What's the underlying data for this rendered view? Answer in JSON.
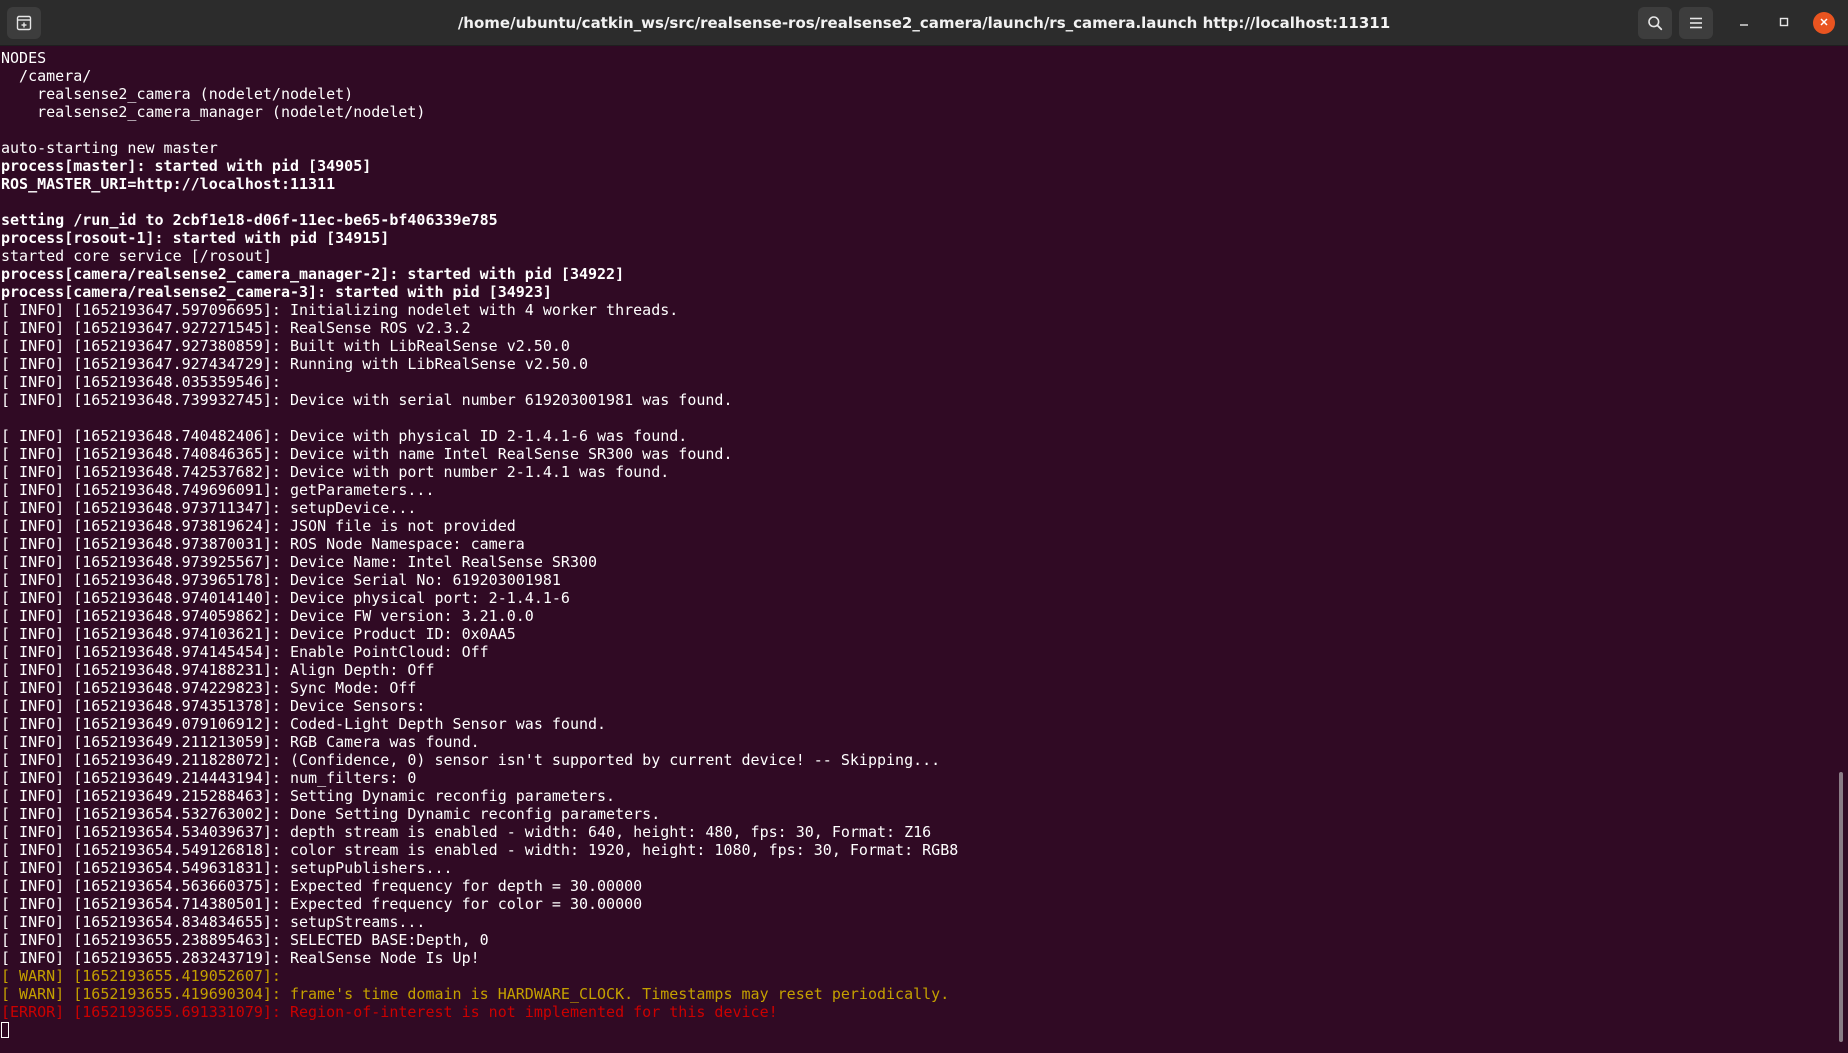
{
  "window": {
    "title": "/home/ubuntu/catkin_ws/src/realsense-ros/realsense2_camera/launch/rs_camera.launch http://localhost:11311"
  },
  "icons": {
    "new_tab": "new-tab-icon",
    "search": "search-icon",
    "menu": "hamburger-menu-icon",
    "minimize": "minimize-icon",
    "maximize": "maximize-icon",
    "close": "close-icon"
  },
  "colors": {
    "terminal_bg": "#300a24",
    "text": "#ffffff",
    "warn": "#c4a000",
    "error": "#cc0000",
    "close_button": "#e95420"
  },
  "terminal": {
    "lines": [
      {
        "text": "NODES",
        "style": "normal"
      },
      {
        "text": "  /camera/",
        "style": "normal"
      },
      {
        "text": "    realsense2_camera (nodelet/nodelet)",
        "style": "normal"
      },
      {
        "text": "    realsense2_camera_manager (nodelet/nodelet)",
        "style": "normal"
      },
      {
        "text": "",
        "style": "normal"
      },
      {
        "text": "auto-starting new master",
        "style": "normal"
      },
      {
        "text": "process[master]: started with pid [34905]",
        "style": "bold"
      },
      {
        "text": "ROS_MASTER_URI=http://localhost:11311",
        "style": "bold"
      },
      {
        "text": "",
        "style": "normal"
      },
      {
        "text": "setting /run_id to 2cbf1e18-d06f-11ec-be65-bf406339e785",
        "style": "bold"
      },
      {
        "text": "process[rosout-1]: started with pid [34915]",
        "style": "bold"
      },
      {
        "text": "started core service [/rosout]",
        "style": "normal"
      },
      {
        "text": "process[camera/realsense2_camera_manager-2]: started with pid [34922]",
        "style": "bold"
      },
      {
        "text": "process[camera/realsense2_camera-3]: started with pid [34923]",
        "style": "bold"
      },
      {
        "text": "[ INFO] [1652193647.597096695]: Initializing nodelet with 4 worker threads.",
        "style": "normal"
      },
      {
        "text": "[ INFO] [1652193647.927271545]: RealSense ROS v2.3.2",
        "style": "normal"
      },
      {
        "text": "[ INFO] [1652193647.927380859]: Built with LibRealSense v2.50.0",
        "style": "normal"
      },
      {
        "text": "[ INFO] [1652193647.927434729]: Running with LibRealSense v2.50.0",
        "style": "normal"
      },
      {
        "text": "[ INFO] [1652193648.035359546]: ",
        "style": "normal"
      },
      {
        "text": "[ INFO] [1652193648.739932745]: Device with serial number 619203001981 was found.",
        "style": "normal"
      },
      {
        "text": "",
        "style": "normal"
      },
      {
        "text": "[ INFO] [1652193648.740482406]: Device with physical ID 2-1.4.1-6 was found.",
        "style": "normal"
      },
      {
        "text": "[ INFO] [1652193648.740846365]: Device with name Intel RealSense SR300 was found.",
        "style": "normal"
      },
      {
        "text": "[ INFO] [1652193648.742537682]: Device with port number 2-1.4.1 was found.",
        "style": "normal"
      },
      {
        "text": "[ INFO] [1652193648.749696091]: getParameters...",
        "style": "normal"
      },
      {
        "text": "[ INFO] [1652193648.973711347]: setupDevice...",
        "style": "normal"
      },
      {
        "text": "[ INFO] [1652193648.973819624]: JSON file is not provided",
        "style": "normal"
      },
      {
        "text": "[ INFO] [1652193648.973870031]: ROS Node Namespace: camera",
        "style": "normal"
      },
      {
        "text": "[ INFO] [1652193648.973925567]: Device Name: Intel RealSense SR300",
        "style": "normal"
      },
      {
        "text": "[ INFO] [1652193648.973965178]: Device Serial No: 619203001981",
        "style": "normal"
      },
      {
        "text": "[ INFO] [1652193648.974014140]: Device physical port: 2-1.4.1-6",
        "style": "normal"
      },
      {
        "text": "[ INFO] [1652193648.974059862]: Device FW version: 3.21.0.0",
        "style": "normal"
      },
      {
        "text": "[ INFO] [1652193648.974103621]: Device Product ID: 0x0AA5",
        "style": "normal"
      },
      {
        "text": "[ INFO] [1652193648.974145454]: Enable PointCloud: Off",
        "style": "normal"
      },
      {
        "text": "[ INFO] [1652193648.974188231]: Align Depth: Off",
        "style": "normal"
      },
      {
        "text": "[ INFO] [1652193648.974229823]: Sync Mode: Off",
        "style": "normal"
      },
      {
        "text": "[ INFO] [1652193648.974351378]: Device Sensors:",
        "style": "normal"
      },
      {
        "text": "[ INFO] [1652193649.079106912]: Coded-Light Depth Sensor was found.",
        "style": "normal"
      },
      {
        "text": "[ INFO] [1652193649.211213059]: RGB Camera was found.",
        "style": "normal"
      },
      {
        "text": "[ INFO] [1652193649.211828072]: (Confidence, 0) sensor isn't supported by current device! -- Skipping...",
        "style": "normal"
      },
      {
        "text": "[ INFO] [1652193649.214443194]: num_filters: 0",
        "style": "normal"
      },
      {
        "text": "[ INFO] [1652193649.215288463]: Setting Dynamic reconfig parameters.",
        "style": "normal"
      },
      {
        "text": "[ INFO] [1652193654.532763002]: Done Setting Dynamic reconfig parameters.",
        "style": "normal"
      },
      {
        "text": "[ INFO] [1652193654.534039637]: depth stream is enabled - width: 640, height: 480, fps: 30, Format: Z16",
        "style": "normal"
      },
      {
        "text": "[ INFO] [1652193654.549126818]: color stream is enabled - width: 1920, height: 1080, fps: 30, Format: RGB8",
        "style": "normal"
      },
      {
        "text": "[ INFO] [1652193654.549631831]: setupPublishers...",
        "style": "normal"
      },
      {
        "text": "[ INFO] [1652193654.563660375]: Expected frequency for depth = 30.00000",
        "style": "normal"
      },
      {
        "text": "[ INFO] [1652193654.714380501]: Expected frequency for color = 30.00000",
        "style": "normal"
      },
      {
        "text": "[ INFO] [1652193654.834834655]: setupStreams...",
        "style": "normal"
      },
      {
        "text": "[ INFO] [1652193655.238895463]: SELECTED BASE:Depth, 0",
        "style": "normal"
      },
      {
        "text": "[ INFO] [1652193655.283243719]: RealSense Node Is Up!",
        "style": "normal"
      },
      {
        "text": "[ WARN] [1652193655.419052607]: ",
        "style": "warn"
      },
      {
        "text": "[ WARN] [1652193655.419690304]: frame's time domain is HARDWARE_CLOCK. Timestamps may reset periodically.",
        "style": "warn"
      },
      {
        "text": "[ERROR] [1652193655.691331079]: Region-of-interest is not implemented for this device!",
        "style": "error"
      }
    ]
  },
  "scrollbar": {
    "position_fraction": 0.7
  }
}
